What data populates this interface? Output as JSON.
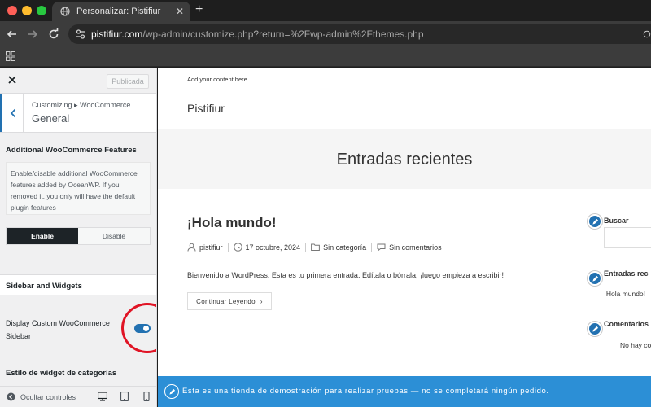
{
  "browser": {
    "tab_title": "Personalizar: Pistifiur",
    "url_host": "pistifiur.com",
    "url_path": "/wp-admin/customize.php?return=%2Fwp-admin%2Fthemes.php"
  },
  "customizer": {
    "publish_label": "Publicada",
    "breadcrumb": "Customizing ▸ WooCommerce",
    "section_title": "General",
    "features": {
      "heading": "Additional WooCommerce Features",
      "description": "Enable/disable additional WooCommerce features added by OceanWP. If you removed it, you only will have the default plugin features",
      "enable_label": "Enable",
      "disable_label": "Disable",
      "selected": "Enable"
    },
    "sidebar_widgets_label": "Sidebar and Widgets",
    "display_sidebar": {
      "label": "Display Custom WooCommerce Sidebar",
      "enabled": true
    },
    "category_style_label": "Estilo de widget de categorías",
    "footer": {
      "collapse_label": "Ocultar controles"
    }
  },
  "preview": {
    "topbar_text": "Add your content here",
    "site_title": "Pistifiur",
    "page_title": "Entradas recientes",
    "post": {
      "title": "¡Hola mundo!",
      "author": "pistifiur",
      "date": "17 octubre, 2024",
      "category": "Sin categoría",
      "comments": "Sin comentarios",
      "excerpt": "Bienvenido a WordPress. Esta es tu primera entrada. Edítala o bórrala, ¡luego empieza a escribir!",
      "read_more": "Continuar Leyendo"
    },
    "widgets": {
      "search_label": "Buscar",
      "recent_label": "Entradas rec",
      "recent_item": "¡Hola mundo!",
      "comments_label": "Comentarios",
      "comments_item": "No hay co"
    },
    "demo_notice": "Esta es una tienda de demostración para realizar pruebas — no se completará ningún pedido."
  }
}
